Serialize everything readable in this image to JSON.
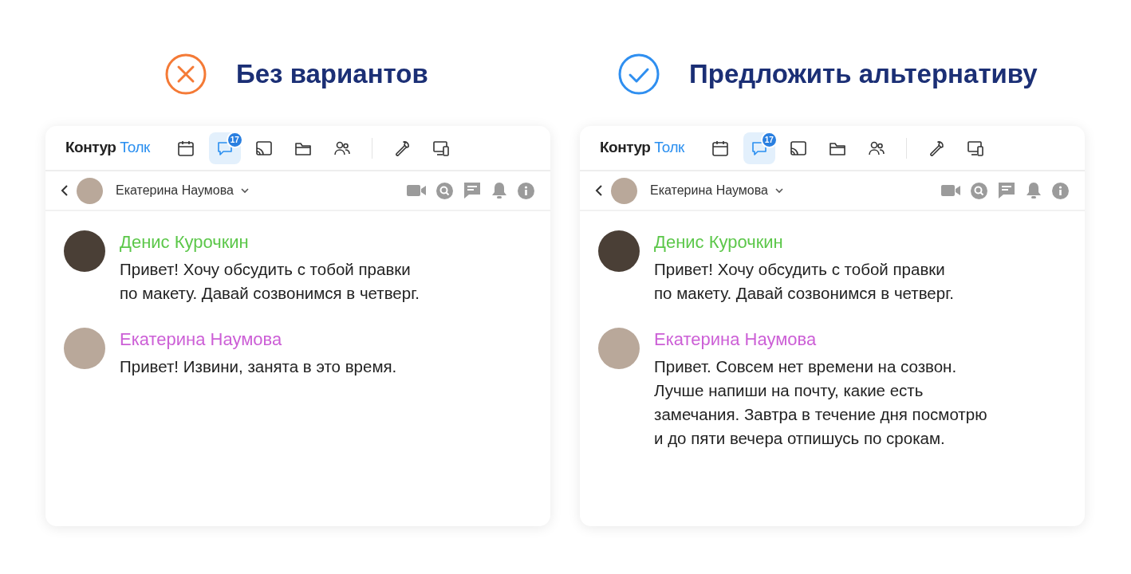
{
  "panels": [
    {
      "kind": "bad",
      "heading": "Без вариантов",
      "app": {
        "logo": {
          "brand": "Контур",
          "product": "Толк"
        },
        "nav": [
          {
            "kind": "calendar",
            "selected": false
          },
          {
            "kind": "chat",
            "selected": true,
            "badge": "17"
          },
          {
            "kind": "cast",
            "selected": false
          },
          {
            "kind": "folder",
            "selected": false
          },
          {
            "kind": "people",
            "selected": false
          },
          {
            "kind": "wrench",
            "selected": false
          },
          {
            "kind": "devices",
            "selected": false
          }
        ],
        "chat_title": "Екатерина Наумова",
        "messages": [
          {
            "author": "Денис Курочкин",
            "color": "#5cc74a",
            "text": "Привет! Хочу обсудить с тобой правки\nпо макету. Давай созвонимся в четверг."
          },
          {
            "author": "Екатерина Наумова",
            "color": "#cc5fd6",
            "text": "Привет! Извини, занята в это время."
          }
        ]
      }
    },
    {
      "kind": "good",
      "heading": "Предложить альтернативу",
      "app": {
        "logo": {
          "brand": "Контур",
          "product": "Толк"
        },
        "nav": [
          {
            "kind": "calendar",
            "selected": false
          },
          {
            "kind": "chat",
            "selected": true,
            "badge": "17"
          },
          {
            "kind": "cast",
            "selected": false
          },
          {
            "kind": "folder",
            "selected": false
          },
          {
            "kind": "people",
            "selected": false
          },
          {
            "kind": "wrench",
            "selected": false
          },
          {
            "kind": "devices",
            "selected": false
          }
        ],
        "chat_title": "Екатерина Наумова",
        "messages": [
          {
            "author": "Денис Курочкин",
            "color": "#5cc74a",
            "text": "Привет! Хочу обсудить с тобой правки\nпо макету. Давай созвонимся в четверг."
          },
          {
            "author": "Екатерина Наумова",
            "color": "#cc5fd6",
            "text": "Привет. Совсем нет времени на созвон.\nЛучше напиши на почту, какие есть\nзамечания. Завтра в течение дня посмотрю\nи до пяти вечера отпишусь по срокам."
          }
        ]
      }
    }
  ]
}
